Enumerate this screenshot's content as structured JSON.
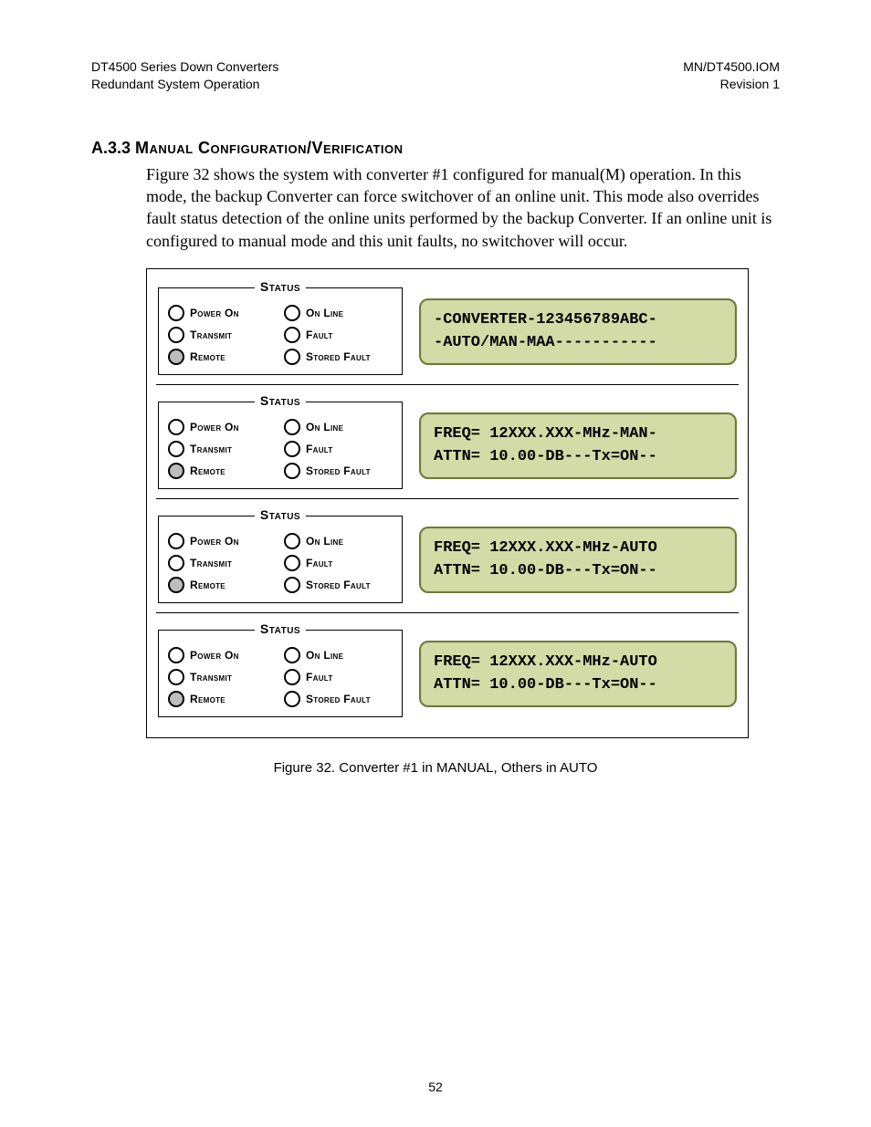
{
  "header": {
    "left_line1": "DT4500 Series Down Converters",
    "left_line2": "Redundant System Operation",
    "right_line1": "MN/DT4500.IOM",
    "right_line2": "Revision 1"
  },
  "heading": {
    "section_number": "A.3.3",
    "title": "Manual Configuration/Verification"
  },
  "paragraph": "Figure 32 shows the system with converter #1 configured for manual(M) operation.  In this mode, the backup Converter can force switchover of an online unit.  This mode also overrides fault status detection of the online units performed by the backup Converter.  If an online unit is configured to manual mode and this unit faults, no switchover will occur.",
  "status_legend": "Status",
  "led_labels": {
    "power_on": "Power On",
    "on_line": "On Line",
    "transmit": "Transmit",
    "fault": "Fault",
    "remote": "Remote",
    "stored_fault": "Stored Fault"
  },
  "panels": [
    {
      "remote_grey": true,
      "lcd_line1": "-CONVERTER-123456789ABC-",
      "lcd_line2": "-AUTO/MAN-MAA-----------"
    },
    {
      "remote_grey": true,
      "lcd_line1": "FREQ= 12XXX.XXX-MHz-MAN-",
      "lcd_line2": "ATTN= 10.00-DB---Tx=ON--"
    },
    {
      "remote_grey": true,
      "lcd_line1": "FREQ= 12XXX.XXX-MHz-AUTO",
      "lcd_line2": "ATTN= 10.00-DB---Tx=ON--"
    },
    {
      "remote_grey": true,
      "lcd_line1": "FREQ= 12XXX.XXX-MHz-AUTO",
      "lcd_line2": "ATTN= 10.00-DB---Tx=ON--"
    }
  ],
  "caption": "Figure 32.  Converter #1 in MANUAL, Others in AUTO",
  "page_number": "52"
}
